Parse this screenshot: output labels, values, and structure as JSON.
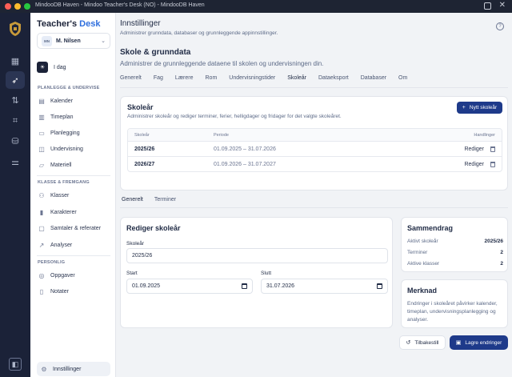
{
  "window": {
    "title": "MindooDB Haven - Mindoo Teacher's Desk (NO) - MindooDB Haven"
  },
  "rail": {
    "icons": [
      "logo-icon",
      "grid-icon",
      "rocket-icon",
      "sync-icon",
      "scan-icon",
      "database-icon",
      "sliders-icon",
      "panel-icon"
    ]
  },
  "sidebar": {
    "brand_main": "Teacher's",
    "brand_accent": "Desk",
    "user": {
      "initials": "MN",
      "name": "M. Nilsen"
    },
    "today_label": "I dag",
    "sections": {
      "plan": "PLANLEGGE & UNDERVISE",
      "classes": "KLASSE & FREMGANG",
      "personal": "PERSONLIG"
    },
    "plan_items": [
      {
        "label": "Kalender",
        "icon": "calendar-icon"
      },
      {
        "label": "Timeplan",
        "icon": "timetable-icon"
      },
      {
        "label": "Planlegging",
        "icon": "clipboard-icon"
      },
      {
        "label": "Undervisning",
        "icon": "presentation-icon"
      },
      {
        "label": "Materiell",
        "icon": "folder-icon"
      }
    ],
    "class_items": [
      {
        "label": "Klasser",
        "icon": "users-icon"
      },
      {
        "label": "Karakterer",
        "icon": "chart-icon"
      },
      {
        "label": "Samtaler & referater",
        "icon": "chat-icon"
      },
      {
        "label": "Analyser",
        "icon": "trend-icon"
      }
    ],
    "personal_items": [
      {
        "label": "Oppgaver",
        "icon": "check-circle-icon"
      },
      {
        "label": "Notater",
        "icon": "note-icon"
      }
    ],
    "settings_label": "Innstillinger"
  },
  "header": {
    "title": "Innstillinger",
    "subtitle": "Administrer grunndata, databaser og grunnleggende appinnstillinger."
  },
  "section": {
    "title": "Skole & grunndata",
    "subtitle": "Administrer de grunnleggende dataene til skolen og undervisningen din."
  },
  "tabs": [
    "Generelt",
    "Fag",
    "Lærere",
    "Rom",
    "Undervisningstider",
    "Skoleår",
    "Dataeksport",
    "Databaser",
    "Om"
  ],
  "active_tab": "Skoleår",
  "school_years": {
    "title": "Skoleår",
    "subtitle": "Administrer skoleår og rediger terminer, ferier, helligdager og fridager for det valgte skoleåret.",
    "new_button": "Nytt skoleår",
    "columns": [
      "Skoleår",
      "Periode",
      "Handlinger"
    ],
    "rows": [
      {
        "year": "2025/26",
        "period": "01.09.2025 – 31.07.2026",
        "action": "Rediger"
      },
      {
        "year": "2026/27",
        "period": "01.09.2026 – 31.07.2027",
        "action": "Rediger"
      }
    ]
  },
  "subtabs": [
    "Generelt",
    "Terminer"
  ],
  "edit": {
    "title": "Rediger skoleår",
    "year_label": "Skoleår",
    "year_value": "2025/26",
    "start_label": "Start",
    "start_value": "01.09.2025",
    "end_label": "Slutt",
    "end_value": "31.07.2026"
  },
  "summary": {
    "title": "Sammendrag",
    "rows": [
      {
        "label": "Aktivt skoleår",
        "value": "2025/26"
      },
      {
        "label": "Terminer",
        "value": "2"
      },
      {
        "label": "Aktive klasser",
        "value": "2"
      }
    ]
  },
  "note": {
    "title": "Merknad",
    "text": "Endringer i skoleåret påvirker kalender, timeplan, undervisningsplanlegging og analyser."
  },
  "actions": {
    "reset": "Tilbakestill",
    "save": "Lagre endringer"
  },
  "colors": {
    "primary": "#1e3a8a",
    "rail": "#1b2238",
    "accent": "#2f6fde"
  }
}
